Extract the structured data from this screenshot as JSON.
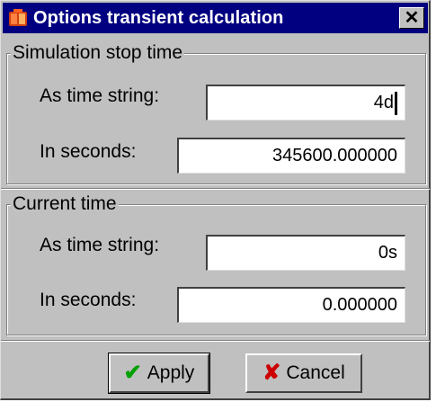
{
  "window": {
    "title": "Options transient calculation",
    "close_glyph": "✕",
    "app_icon": "app-icon"
  },
  "stop_time": {
    "group_title": "Simulation stop time",
    "time_string_label": "As time string:",
    "time_string_value": "4d",
    "seconds_label": "In seconds:",
    "seconds_value": "345600.000000"
  },
  "current_time": {
    "group_title": "Current time",
    "time_string_label": "As time string:",
    "time_string_value": "0s",
    "seconds_label": "In seconds:",
    "seconds_value": "0.000000"
  },
  "buttons": {
    "apply_label": "Apply",
    "apply_icon": "checkmark-icon",
    "apply_icon_glyph": "✔",
    "apply_icon_color": "#00a000",
    "cancel_label": "Cancel",
    "cancel_icon": "x-cross-icon",
    "cancel_icon_glyph": "✘",
    "cancel_icon_color": "#cc0000"
  },
  "colors": {
    "titlebar": "#000080",
    "dialog_bg": "#c0c0c0"
  }
}
